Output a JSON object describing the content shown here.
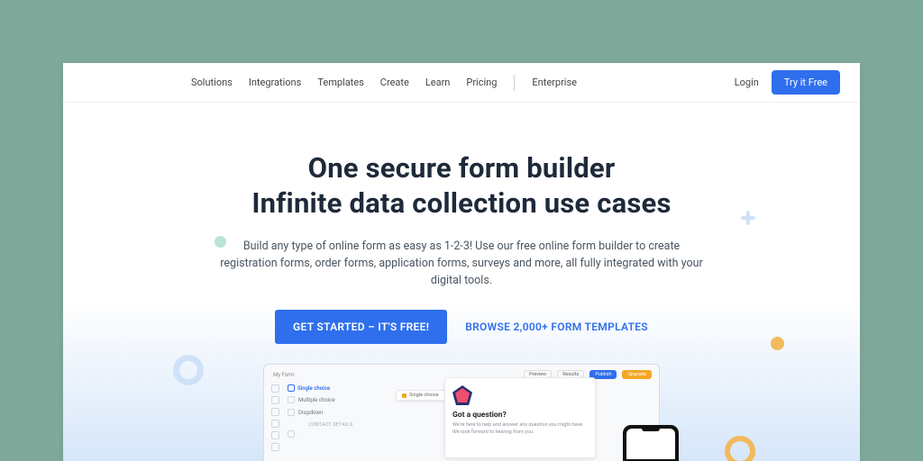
{
  "nav": {
    "items": [
      "Solutions",
      "Integrations",
      "Templates",
      "Create",
      "Learn",
      "Pricing"
    ],
    "enterprise": "Enterprise",
    "login": "Login",
    "cta": "Try it Free"
  },
  "hero": {
    "title_line1": "One secure form builder",
    "title_line2": "Infinite data collection use cases",
    "subhead": "Build any type of online form as easy as 1-2-3! Use our free online form builder to create registration forms, order forms, application forms, surveys and more, all fully integrated with your digital tools.",
    "primary_cta": "GET STARTED – IT'S FREE!",
    "secondary_cta": "BROWSE 2,000+ FORM TEMPLATES"
  },
  "mockup": {
    "form_title": "My Form",
    "toolbar": {
      "preview": "Preview",
      "results": "Results",
      "publish": "Publish",
      "upgrade": "Upgrade"
    },
    "field_head": "Single choice",
    "fields": [
      "Multiple choice",
      "Dropdown"
    ],
    "section": "Contact Details",
    "tag": "Single choice",
    "question": {
      "title": "Got a question?",
      "body": "We're here to help and answer any question you might have. We look forward to hearing from you."
    }
  }
}
